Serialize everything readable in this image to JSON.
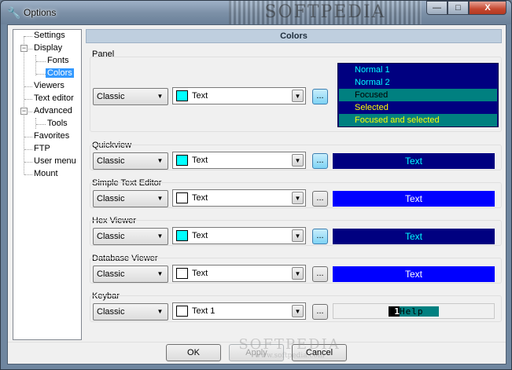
{
  "window": {
    "title": "Options",
    "title_icon": "wrench-icon",
    "watermark": "SOFTPEDIA",
    "controls": {
      "minimize": "—",
      "maximize": "□",
      "close": "X"
    }
  },
  "tree": {
    "items": [
      {
        "label": "Settings"
      },
      {
        "label": "Display",
        "expander": "−"
      },
      {
        "label": "Fonts"
      },
      {
        "label": "Colors",
        "selected": true
      },
      {
        "label": "Viewers"
      },
      {
        "label": "Text editor"
      },
      {
        "label": "Advanced",
        "expander": "−"
      },
      {
        "label": "Tools"
      },
      {
        "label": "Favorites"
      },
      {
        "label": "FTP"
      },
      {
        "label": "User menu"
      },
      {
        "label": "Mount"
      }
    ]
  },
  "header": {
    "title": "Colors"
  },
  "sections": {
    "panel": {
      "label": "Panel",
      "scheme": "Classic",
      "color_text": "Text",
      "swatch": "#00ffff",
      "dots": "...",
      "dots_active": true
    },
    "quickview": {
      "label": "Quickview",
      "scheme": "Classic",
      "color_text": "Text",
      "swatch": "#00ffff",
      "dots": "...",
      "dots_active": true,
      "preview_text": "Text",
      "preview_bg": "#000080",
      "preview_fg": "#00ffff"
    },
    "simple_text_editor": {
      "label": "Simple Text Editor",
      "scheme": "Classic",
      "color_text": "Text",
      "swatch": "#ffffff",
      "dots": "...",
      "dots_active": false,
      "preview_text": "Text",
      "preview_bg": "#0000ff",
      "preview_fg": "#ffffff"
    },
    "hex_viewer": {
      "label": "Hex Viewer",
      "scheme": "Classic",
      "color_text": "Text",
      "swatch": "#00ffff",
      "dots": "...",
      "dots_active": true,
      "preview_text": "Text",
      "preview_bg": "#000080",
      "preview_fg": "#00ffff"
    },
    "database_viewer": {
      "label": "Database Viewer",
      "scheme": "Classic",
      "color_text": "Text",
      "swatch": "#ffffff",
      "dots": "...",
      "dots_active": false,
      "preview_text": "Text",
      "preview_bg": "#0000ff",
      "preview_fg": "#ffffff"
    },
    "keybar": {
      "label": "Keybar",
      "scheme": "Classic",
      "color_text": "Text 1",
      "swatch": "#ffffff",
      "dots": "...",
      "dots_active": false,
      "key_number": "1",
      "key_label": "Help"
    }
  },
  "panel_preview": [
    {
      "text": "Normal 1",
      "fg": "#00ffff",
      "bg": "#000080"
    },
    {
      "text": "Normal 2",
      "fg": "#00ffff",
      "bg": "#000080"
    },
    {
      "text": "Focused",
      "fg": "#000000",
      "bg": "#008080"
    },
    {
      "text": "Selected",
      "fg": "#ffff00",
      "bg": "#000080"
    },
    {
      "text": "Focused and selected",
      "fg": "#ffff00",
      "bg": "#008080"
    }
  ],
  "footer": {
    "ok": "OK",
    "apply": "Apply",
    "cancel": "Cancel",
    "watermark": "SOFTPEDIA",
    "watermark_url": "www.softpedia.com"
  }
}
